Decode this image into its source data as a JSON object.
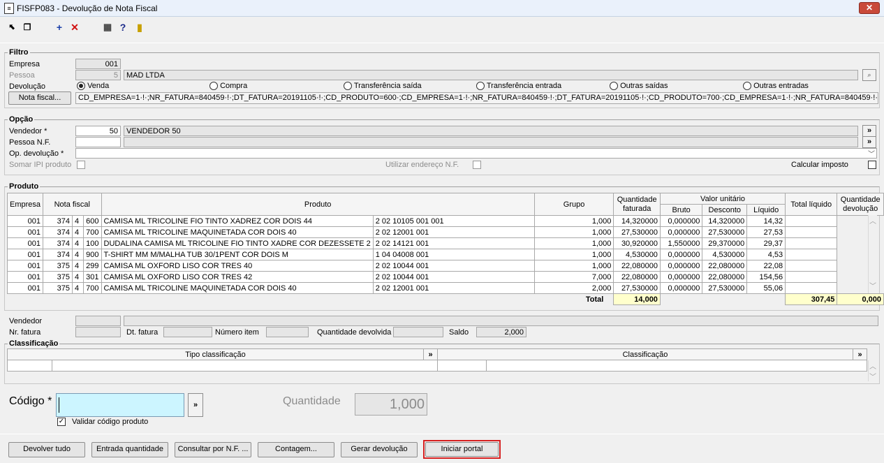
{
  "window": {
    "title": "FISFP083 - Devolução de Nota Fiscal",
    "close_label": "✕"
  },
  "filtro": {
    "section": "Filtro",
    "empresa_label": "Empresa",
    "empresa_value": "001",
    "pessoa_label": "Pessoa",
    "pessoa_code": "5",
    "pessoa_name": "MAD LTDA",
    "devolucao_label": "Devolução",
    "radios": [
      "Venda",
      "Compra",
      "Transferência saída",
      "Transferência entrada",
      "Outras saídas",
      "Outras entradas"
    ],
    "selected_radio": "Venda",
    "nota_btn": "Nota fiscal...",
    "nota_value": "CD_EMPRESA=1·!·;NR_FATURA=840459·!·;DT_FATURA=20191105·!·;CD_PRODUTO=600·;CD_EMPRESA=1·!·;NR_FATURA=840459·!·;DT_FATURA=20191105·!·;CD_PRODUTO=700·;CD_EMPRESA=1·!·;NR_FATURA=840459·!·;DT_FATURA=2"
  },
  "opcao": {
    "section": "Opção",
    "vendedor_label": "Vendedor *",
    "vendedor_code": "50",
    "vendedor_name": "VENDEDOR 50",
    "pessoa_nf_label": "Pessoa N.F.",
    "op_devolucao_label": "Op. devolução *",
    "somar_ipi_label": "Somar IPI produto",
    "utilizar_endereco_label": "Utilizar endereço N.F.",
    "calcular_imposto_label": "Calcular imposto",
    "lookup": "»"
  },
  "produto": {
    "section": "Produto",
    "headers": {
      "empresa": "Empresa",
      "nota": "Nota fiscal",
      "produto": "Produto",
      "grupo": "Grupo",
      "qtd_fat": "Quantidade faturada",
      "valor_unit": "Valor unitário",
      "bruto": "Bruto",
      "desconto": "Desconto",
      "liquido": "Líquido",
      "total_liq": "Total líquido",
      "qtd_dev": "Quantidade devolução"
    },
    "rows": [
      [
        "001",
        "374",
        "4",
        "600",
        "CAMISA ML TRICOLINE FIO TINTO XADREZ COR DOIS 44",
        "2 02 10105 001 001",
        "1,000",
        "14,320000",
        "0,000000",
        "14,320000",
        "14,32",
        ""
      ],
      [
        "001",
        "374",
        "4",
        "700",
        "CAMISA ML TRICOLINE MAQUINETADA COR DOIS 40",
        "2 02 12001 001",
        "1,000",
        "27,530000",
        "0,000000",
        "27,530000",
        "27,53",
        ""
      ],
      [
        "001",
        "374",
        "4",
        "100",
        "DUDALINA CAMISA ML TRICOLINE FIO TINTO XADRE COR DEZESSETE 2",
        "2 02 14121 001",
        "1,000",
        "30,920000",
        "1,550000",
        "29,370000",
        "29,37",
        ""
      ],
      [
        "001",
        "374",
        "4",
        "900",
        "T-SHIRT MM M/MALHA TUB 30/1PENT COR DOIS M",
        "1 04 04008 001",
        "1,000",
        "4,530000",
        "0,000000",
        "4,530000",
        "4,53",
        ""
      ],
      [
        "001",
        "375",
        "4",
        "299",
        "CAMISA ML OXFORD LISO COR TRES 40",
        "2 02 10044 001",
        "1,000",
        "22,080000",
        "0,000000",
        "22,080000",
        "22,08",
        ""
      ],
      [
        "001",
        "375",
        "4",
        "301",
        "CAMISA ML OXFORD LISO COR TRES 42",
        "2 02 10044 001",
        "7,000",
        "22,080000",
        "0,000000",
        "22,080000",
        "154,56",
        ""
      ],
      [
        "001",
        "375",
        "4",
        "700",
        "CAMISA ML TRICOLINE MAQUINETADA COR DOIS 40",
        "2 02 12001 001",
        "2,000",
        "27,530000",
        "0,000000",
        "27,530000",
        "55,06",
        ""
      ]
    ],
    "total_label": "Total",
    "total_qtd": "14,000",
    "total_liquido": "307,45",
    "total_dev": "0,000"
  },
  "detalhe": {
    "vendedor_label": "Vendedor",
    "nr_fatura_label": "Nr. fatura",
    "dt_fatura_label": "Dt. fatura",
    "numero_item_label": "Número item",
    "qtd_devolvida_label": "Quantidade devolvida",
    "saldo_label": "Saldo",
    "saldo_value": "2,000"
  },
  "classificacao": {
    "section": "Classificação",
    "tipo_header": "Tipo classificação",
    "class_header": "Classificação"
  },
  "codigo": {
    "label": "Código *",
    "quantidade_label": "Quantidade",
    "quantidade_value": "1,000",
    "validar_label": "Validar código produto"
  },
  "actions": [
    "Devolver tudo",
    "Entrada quantidade",
    "Consultar por N.F. ...",
    "Contagem...",
    "Gerar devolução",
    "Iniciar portal"
  ],
  "colors": {
    "highlight_border": "#d62020",
    "code_input_bg": "#ccf5ff"
  }
}
